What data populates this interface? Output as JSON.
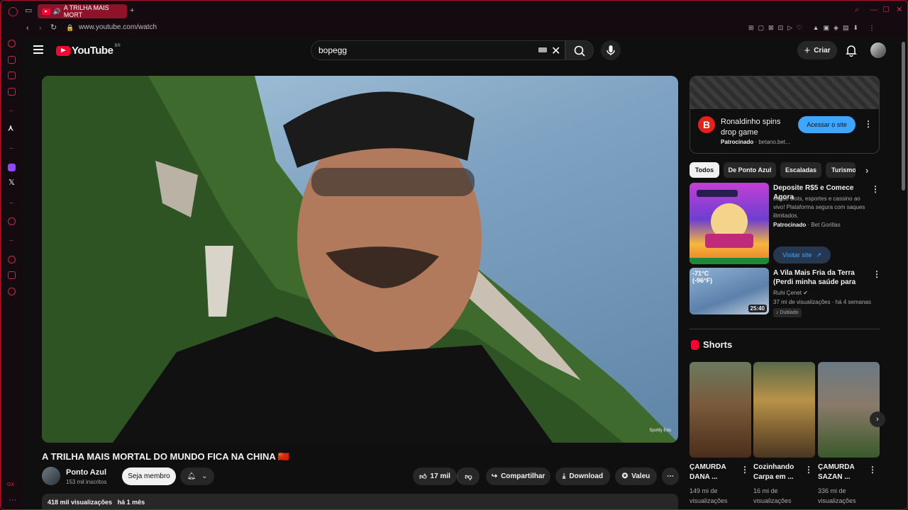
{
  "browser": {
    "tab_title": "A TRILHA MAIS MORT",
    "url": "www.youtube.com/watch",
    "accent_color": "#d22646"
  },
  "youtube": {
    "logo_text": "YouTube",
    "country_code": "BR",
    "search_value": "bopegg",
    "create_label": "Criar"
  },
  "video": {
    "title": "A TRILHA MAIS MORTAL DO MUNDO FICA NA CHINA 🇨🇳",
    "watermark": "Spotify Edu",
    "channel_name": "Ponto Azul",
    "subscribers": "153 mil inscritos",
    "join_label": "Seja membro",
    "likes": "17 mil",
    "share_label": "Compartilhar",
    "download_label": "Download",
    "thanks_label": "Valeu",
    "views": "418 mil visualizações",
    "age": "há 1 mês"
  },
  "ad_top": {
    "title": "Ronaldinho spins drop game",
    "sponsored": "Patrocinado",
    "domain": "betano.bet...",
    "cta": "Acessar o site"
  },
  "chips": [
    "Todos",
    "De Ponto Azul",
    "Escaladas",
    "Turismo"
  ],
  "recommended": [
    {
      "title": "Deposite R$5 e Comece Agora",
      "desc": "Jogue slots, esportes e cassino ao vivo! Plataforma segura com saques ilimitados.",
      "sponsored": "Patrocinado",
      "advertiser": "Bet Gorillas",
      "cta": "Visitar site"
    },
    {
      "title": "A Vila Mais Fria da Terra (Perdi minha saúde para sempre nes...",
      "channel": "Ruhi Çenet",
      "meta": "37 mi de visualizações · há 4 semanas",
      "badge": "Dublado",
      "duration": "25:40",
      "thumb_text": "-71°C (-96°F)"
    }
  ],
  "shorts": {
    "header": "Shorts",
    "items": [
      {
        "title": "ÇAMURDA DANA ...",
        "views": "149 mi de visualizações"
      },
      {
        "title": "Cozinhando Carpa em ...",
        "views": "16 mi de visualizações"
      },
      {
        "title": "ÇAMURDA SAZAN ...",
        "views": "336 mi de visualizações"
      }
    ]
  }
}
